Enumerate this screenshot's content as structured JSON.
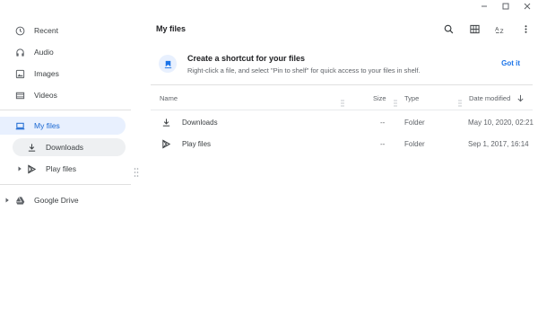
{
  "sidebar": {
    "items": [
      {
        "label": "Recent",
        "icon": "clock-icon"
      },
      {
        "label": "Audio",
        "icon": "headphones-icon"
      },
      {
        "label": "Images",
        "icon": "image-icon"
      },
      {
        "label": "Videos",
        "icon": "video-icon"
      },
      {
        "label": "My files",
        "icon": "laptop-icon"
      },
      {
        "label": "Downloads",
        "icon": "download-icon"
      },
      {
        "label": "Play files",
        "icon": "play-store-icon"
      },
      {
        "label": "Google Drive",
        "icon": "google-drive-icon"
      }
    ]
  },
  "header": {
    "title": "My files"
  },
  "banner": {
    "title": "Create a shortcut for your files",
    "text": "Right-click a file, and select \"Pin to shelf\" for quick access to your files in shelf.",
    "button": "Got it"
  },
  "table": {
    "columns": [
      "Name",
      "Size",
      "Type",
      "Date modified"
    ],
    "rows": [
      {
        "name": "Downloads",
        "size": "--",
        "type": "Folder",
        "date": "May 10, 2020, 02:21",
        "icon": "download-icon"
      },
      {
        "name": "Play files",
        "size": "--",
        "type": "Folder",
        "date": "Sep 1, 2017, 16:14",
        "icon": "play-store-icon"
      }
    ]
  },
  "colors": {
    "accent": "#1a73e8",
    "selected_bg": "#e8f0fe"
  }
}
